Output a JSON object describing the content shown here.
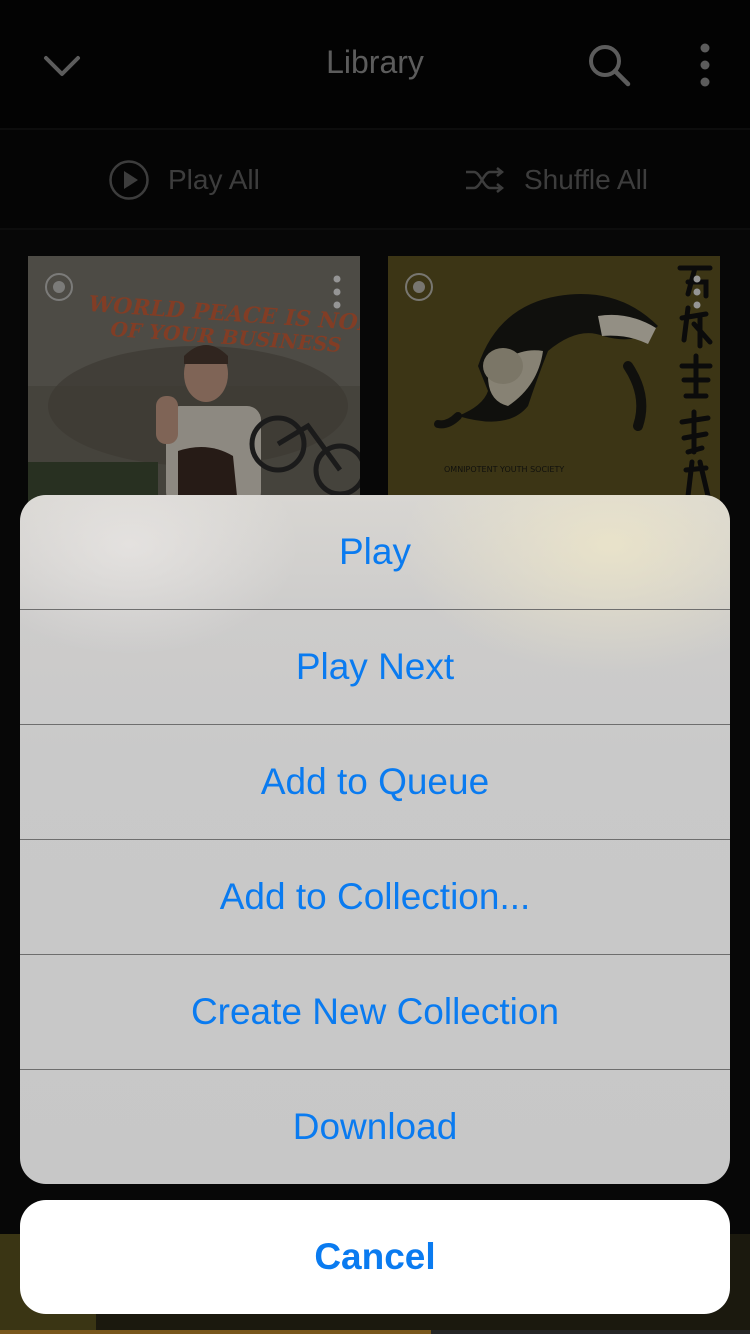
{
  "header": {
    "title": "Library",
    "back_icon": "chevron-down-icon",
    "search_icon": "search-icon",
    "more_icon": "more-vertical-icon"
  },
  "play_bar": {
    "play_all_label": "Play All",
    "shuffle_all_label": "Shuffle All"
  },
  "albums": [
    {
      "cover_text_line1": "WORLD PEACE IS NONE",
      "cover_text_line2": "OF YOUR BUSINESS"
    },
    {
      "cover_text": "OMNIPOTENT YOUTH SOCIETY"
    }
  ],
  "action_sheet": {
    "actions": [
      "Play",
      "Play Next",
      "Add to Queue",
      "Add to Collection...",
      "Create New Collection",
      "Download"
    ],
    "cancel_label": "Cancel"
  },
  "now_playing": {
    "progress": 0.575
  },
  "colors": {
    "accent": "#0a7bf0",
    "progress": "#b8862c"
  }
}
